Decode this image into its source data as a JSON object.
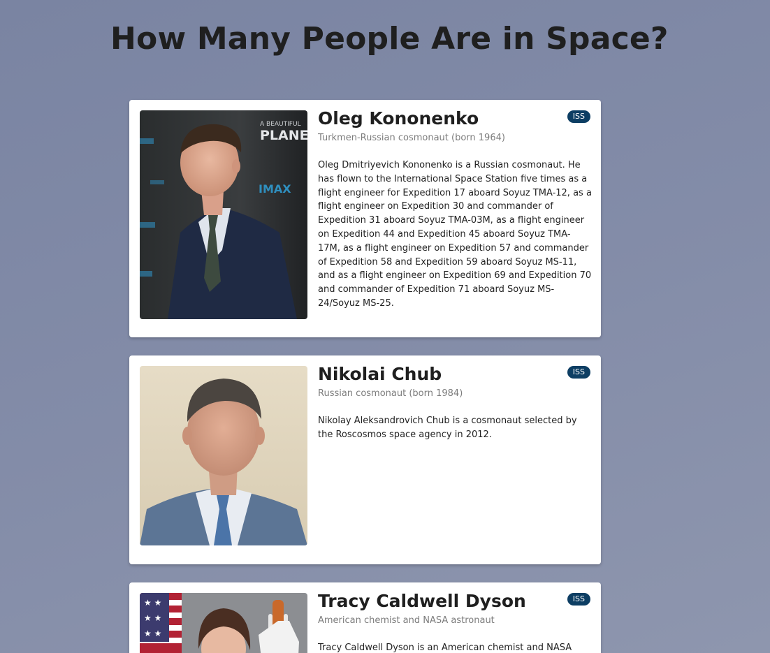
{
  "page": {
    "title": "How Many People Are in Space?"
  },
  "colors": {
    "background": "#838ca8",
    "card": "#ffffff",
    "badge": "#0d3e63",
    "title_text": "#1f1f1f",
    "subtitle_text": "#7c7c7c"
  },
  "astronauts": [
    {
      "name": "Oleg Kononenko",
      "subtitle": "Turkmen-Russian cosmonaut (born 1964)",
      "bio": "Oleg Dmitriyevich Kononenko is a Russian cosmonaut. He has flown to the International Space Station five times as a flight engineer for Expedition 17 aboard Soyuz TMA-12, as a flight engineer on Expedition 30 and commander of Expedition 31 aboard Soyuz TMA-03M, as a flight engineer on Expedition 44 and Expedition 45 aboard Soyuz TMA-17M, as a flight engineer on Expedition 57 and commander of Expedition 58 and Expedition 59 aboard Soyuz MS-11, and as a flight engineer on Expedition 69 and Expedition 70 and commander of Expedition 71 aboard Soyuz MS-24/Soyuz MS-25.",
      "badge": "ISS",
      "photo_backdrop": {
        "line1": "A BEAUTIFUL",
        "line2": "PLANET",
        "brand": "IMAX"
      }
    },
    {
      "name": "Nikolai Chub",
      "subtitle": "Russian cosmonaut (born 1984)",
      "bio": "Nikolay Aleksandrovich Chub is a cosmonaut selected by the Roscosmos space agency in 2012.",
      "badge": "ISS"
    },
    {
      "name": "Tracy Caldwell Dyson",
      "subtitle": "American chemist and NASA astronaut",
      "bio": "Tracy Caldwell Dyson is an American chemist and NASA astronaut.",
      "badge": "ISS"
    }
  ]
}
